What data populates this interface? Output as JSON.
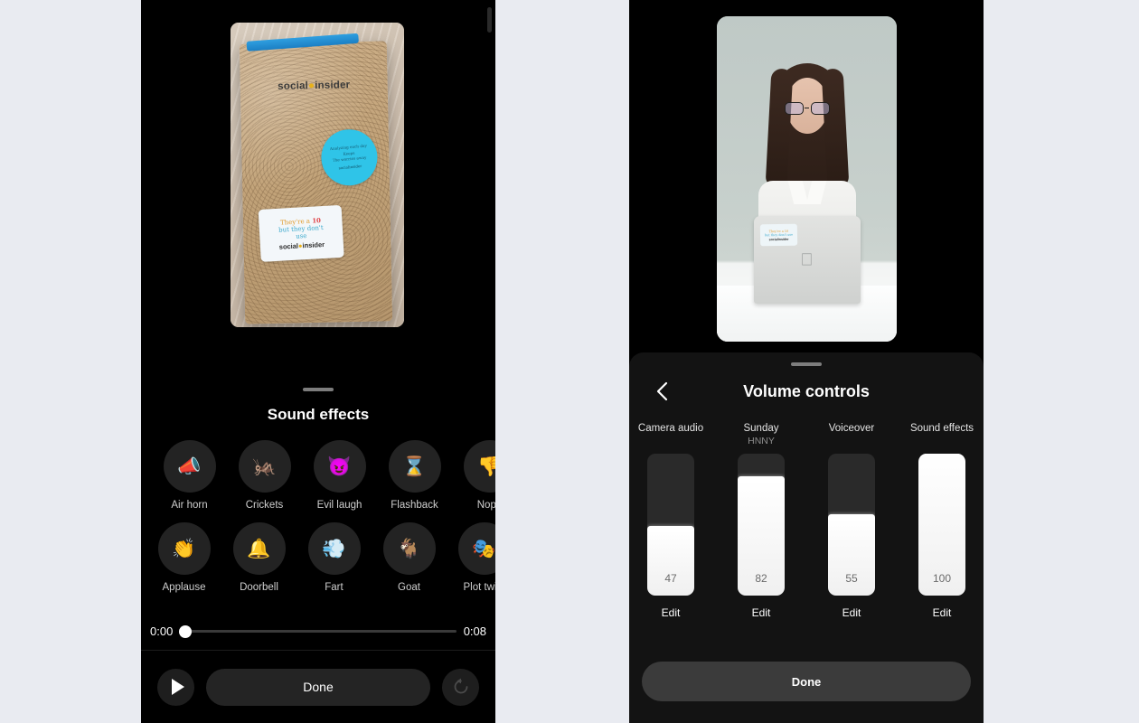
{
  "background_color": "#e9ebf1",
  "left_phone": {
    "status_bar": {
      "time": "",
      "icons": ""
    },
    "media": {
      "type": "photo",
      "description": "Cork-cover notebook on a wooden desk",
      "notebook_logo": "social",
      "notebook_logo_dot": "●",
      "notebook_logo_rest": "insider",
      "round_sticker": {
        "line1": "Analyzing each day",
        "line2": "Keeps",
        "line3": "The worries away",
        "brand": "socialinsider",
        "color": "#2fc4e8"
      },
      "rect_sticker": {
        "line1_pre": "They're a ",
        "line1_ten": "10",
        "line2": "but they don't",
        "line3": "use",
        "brand_pre": "social",
        "brand_dot": "●",
        "brand_post": "insider"
      }
    },
    "sheet": {
      "title": "Sound effects",
      "effects_row1": [
        {
          "label": "Air horn",
          "icon": "📣",
          "icon_name": "megaphone-icon"
        },
        {
          "label": "Crickets",
          "icon": "🦗",
          "icon_name": "cricket-icon"
        },
        {
          "label": "Evil laugh",
          "icon": "😈",
          "icon_name": "devil-icon"
        },
        {
          "label": "Flashback",
          "icon": "⌛",
          "icon_name": "hourglass-icon"
        },
        {
          "label": "Nope",
          "icon": "👎",
          "icon_name": "thumbs-down-icon"
        }
      ],
      "effects_row2": [
        {
          "label": "Applause",
          "icon": "👏",
          "icon_name": "clapping-hands-icon"
        },
        {
          "label": "Doorbell",
          "icon": "🔔",
          "icon_name": "bell-icon"
        },
        {
          "label": "Fart",
          "icon": "💨",
          "icon_name": "dash-icon"
        },
        {
          "label": "Goat",
          "icon": "🐐",
          "icon_name": "goat-icon"
        },
        {
          "label": "Plot twist",
          "icon": "🎭",
          "icon_name": "masks-icon"
        }
      ],
      "timeline": {
        "current_time": "0:00",
        "total_time": "0:08",
        "progress_percent": 0
      },
      "actions": {
        "play_label": "▶",
        "done_label": "Done",
        "undo_label": "↺"
      }
    }
  },
  "right_phone": {
    "media": {
      "type": "video",
      "description": "Woman with glasses working at a laptop on a white desk",
      "laptop_sticker": {
        "line1": "They're a 10",
        "line2": "but they don't use",
        "brand": "socialinsider"
      }
    },
    "sheet": {
      "back_label": "Back",
      "title": "Volume controls",
      "channels": [
        {
          "name": "Camera audio",
          "subtitle": "",
          "value": 47,
          "edit_label": "Edit"
        },
        {
          "name": "Sunday",
          "subtitle": "HNNY",
          "value": 82,
          "edit_label": "Edit"
        },
        {
          "name": "Voiceover",
          "subtitle": "",
          "value": 55,
          "edit_label": "Edit"
        },
        {
          "name": "Sound effects",
          "subtitle": "",
          "value": 100,
          "edit_label": "Edit"
        }
      ],
      "done_label": "Done"
    }
  }
}
